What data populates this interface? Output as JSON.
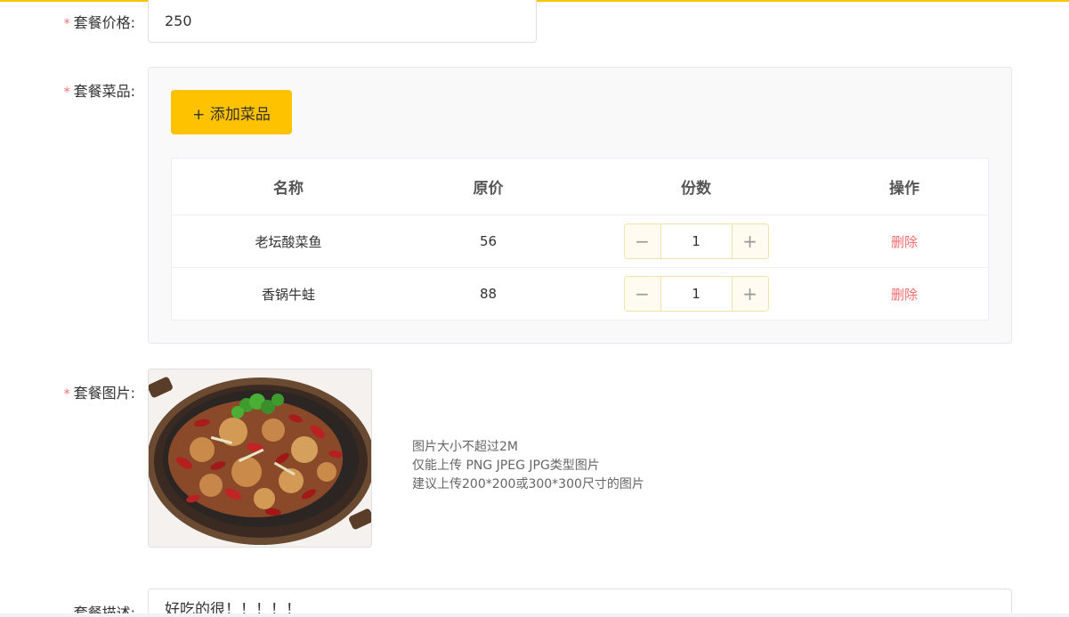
{
  "form": {
    "price": {
      "label": "套餐价格:",
      "value": "250"
    },
    "dishes": {
      "label": "套餐菜品:",
      "add_button": "+ 添加菜品",
      "columns": [
        "名称",
        "原价",
        "份数",
        "操作"
      ],
      "rows": [
        {
          "name": "老坛酸菜鱼",
          "price": "56",
          "count": "1",
          "action": "删除"
        },
        {
          "name": "香锅牛蛙",
          "price": "88",
          "count": "1",
          "action": "删除"
        }
      ]
    },
    "image": {
      "label": "套餐图片:",
      "tips": [
        "图片大小不超过2M",
        "仅能上传 PNG JPEG JPG类型图片",
        "建议上传200*200或300*300尺寸的图片"
      ]
    },
    "description": {
      "label": "套餐描述:",
      "value": "好吃的很！！！！！"
    }
  },
  "colors": {
    "accent": "#ffc200",
    "danger": "#f56c6c",
    "panel_bg": "#f9f9f9"
  }
}
